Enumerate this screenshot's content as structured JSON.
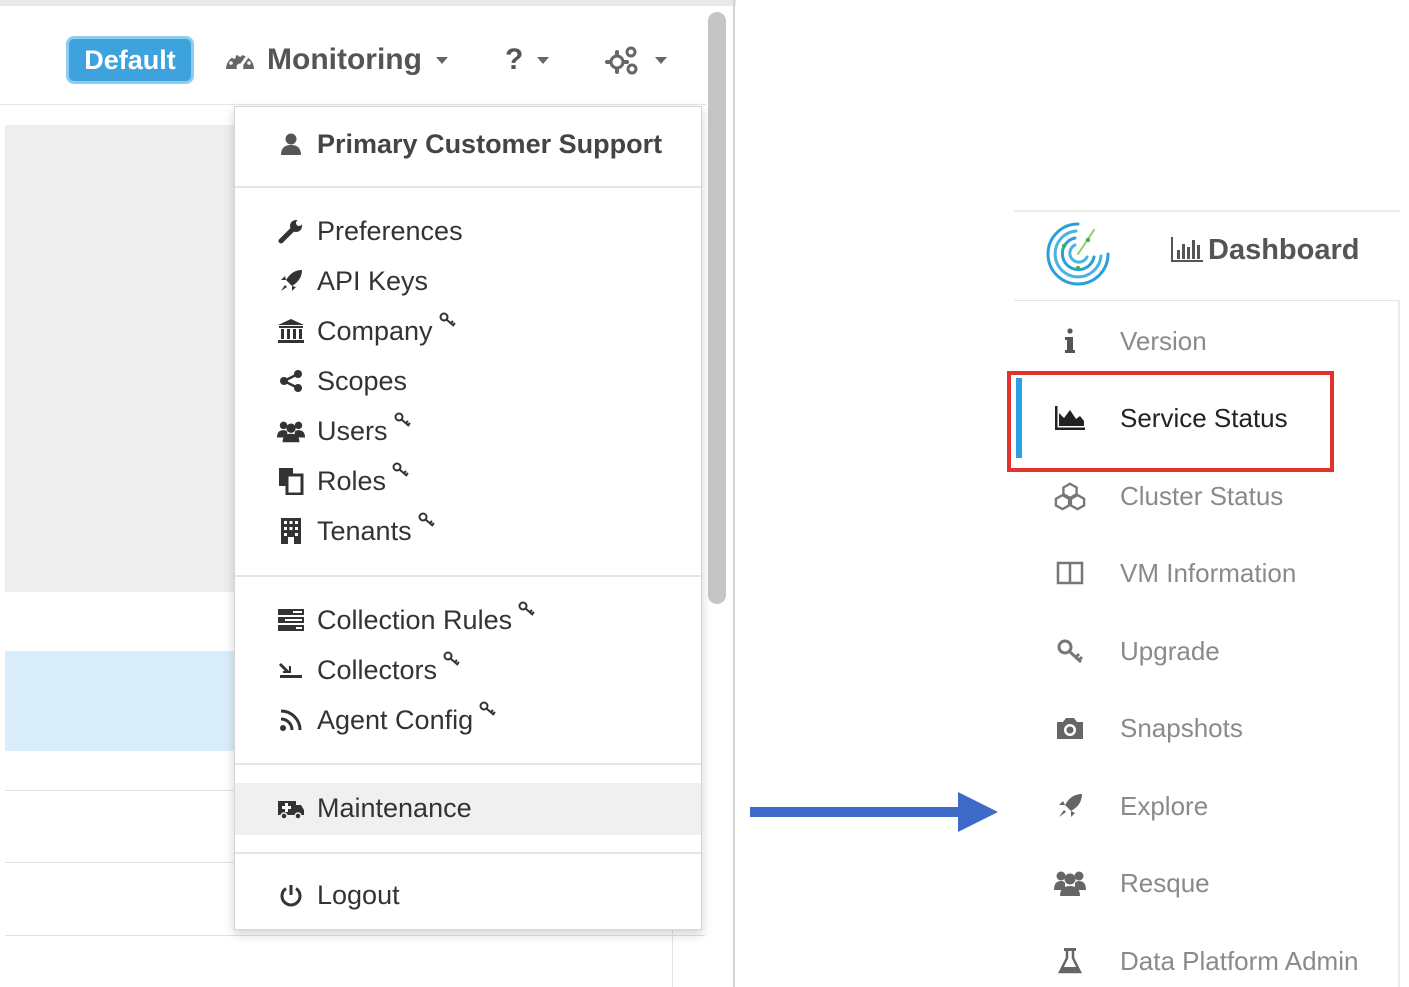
{
  "navbar": {
    "tenant_badge": "Default",
    "monitoring_label": "Monitoring",
    "help_label": "?"
  },
  "user_menu": {
    "header": "Primary Customer Support",
    "group1": [
      {
        "label": "Preferences",
        "icon": "wrench-icon",
        "admin": false
      },
      {
        "label": "API Keys",
        "icon": "rocket-icon",
        "admin": false
      },
      {
        "label": "Company",
        "icon": "institution-icon",
        "admin": true
      },
      {
        "label": "Scopes",
        "icon": "share-icon",
        "admin": false
      },
      {
        "label": "Users",
        "icon": "users-icon",
        "admin": true
      },
      {
        "label": "Roles",
        "icon": "copy-icon",
        "admin": true
      },
      {
        "label": "Tenants",
        "icon": "building-icon",
        "admin": true
      }
    ],
    "group2": [
      {
        "label": "Collection Rules",
        "icon": "tasks-icon",
        "admin": true
      },
      {
        "label": "Collectors",
        "icon": "cloud-download-icon",
        "admin": true
      },
      {
        "label": "Agent Config",
        "icon": "feed-icon",
        "admin": true
      }
    ],
    "maintenance": "Maintenance",
    "logout": "Logout"
  },
  "sidebar": {
    "title": "Dashboard",
    "items": [
      {
        "label": "Version",
        "icon": "info-icon"
      },
      {
        "label": "Service Status",
        "icon": "area-chart-icon",
        "active": true
      },
      {
        "label": "Cluster Status",
        "icon": "cubes-icon"
      },
      {
        "label": "VM Information",
        "icon": "columns-icon"
      },
      {
        "label": "Upgrade",
        "icon": "key-icon"
      },
      {
        "label": "Snapshots",
        "icon": "camera-icon"
      },
      {
        "label": "Explore",
        "icon": "rocket-icon"
      },
      {
        "label": "Resque",
        "icon": "users-icon"
      },
      {
        "label": "Data Platform Admin",
        "icon": "flask-icon"
      }
    ]
  },
  "colors": {
    "badge": "#3ea3dc",
    "active_bar": "#2d9fe0",
    "highlight": "#e3312d",
    "arrow": "#3e6bc9"
  }
}
